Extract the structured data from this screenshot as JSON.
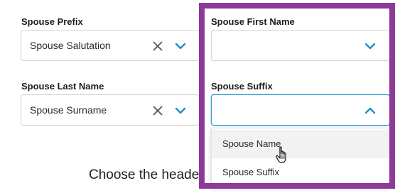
{
  "fields": {
    "spouse_prefix": {
      "label": "Spouse Prefix",
      "value": "Spouse Salutation"
    },
    "spouse_first_name": {
      "label": "Spouse First Name",
      "value": ""
    },
    "spouse_last_name": {
      "label": "Spouse Last Name",
      "value": "Spouse Surname"
    },
    "spouse_suffix": {
      "label": "Spouse Suffix",
      "value": ""
    }
  },
  "dropdown": {
    "options": [
      "Spouse Name",
      "Spouse Suffix"
    ],
    "hovered_index": 0
  },
  "background_text": "Choose the heade",
  "colors": {
    "highlight_border": "#8e3a98",
    "focus_border": "#2a9bd6",
    "chevron": "#1f8fc9",
    "clear_icon": "#555555"
  },
  "icons": [
    "clear-icon",
    "chevron-down-icon",
    "chevron-up-icon",
    "hand-pointer-icon"
  ]
}
